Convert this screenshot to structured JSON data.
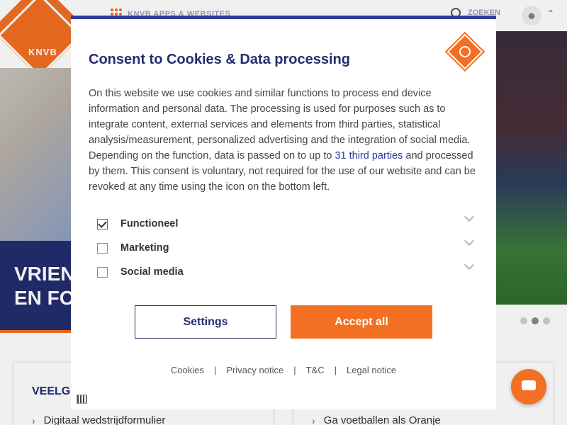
{
  "header": {
    "logo_text": "KNVB",
    "apps_label": "KNVB APPS & WEBSITES",
    "search_label": "ZOEKEN"
  },
  "hero": {
    "title_line1": "VRIEN",
    "title_line2": "EN FO",
    "carousel": {
      "total": 3,
      "active_index": 1
    }
  },
  "cards": {
    "left_title": "VEELG",
    "left_link": "Digitaal wedstrijdformulier",
    "right_link": "Ga voetballen als Oranje"
  },
  "modal": {
    "title": "Consent to Cookies & Data processing",
    "body_part1": "On this website we use cookies and similar functions to process end device information and personal data. The processing is used for purposes such as to integrate content, external services and elements from third parties, statistical analysis/measurement, personalized advertising and the integration of social media. Depending on the function, data is passed on to up to ",
    "body_link": "31 third parties",
    "body_part2": " and processed by them. This consent is voluntary, not required for the use of our website and can be revoked at any time using the icon on the bottom left.",
    "options": [
      {
        "label": "Functioneel",
        "checked": true
      },
      {
        "label": "Marketing",
        "checked": false
      },
      {
        "label": "Social media",
        "checked": false
      }
    ],
    "settings_button": "Settings",
    "accept_button": "Accept all",
    "footer": {
      "cookies": "Cookies",
      "privacy": "Privacy notice",
      "tc": "T&C",
      "legal": "Legal notice",
      "separator": "|"
    }
  },
  "colors": {
    "brand_orange": "#f36f21",
    "brand_navy": "#232d6e",
    "link_blue": "#2d3b9e"
  }
}
